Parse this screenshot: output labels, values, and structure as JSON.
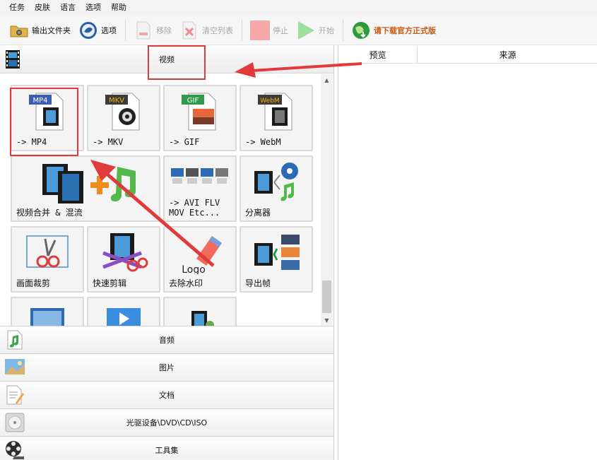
{
  "menu": [
    "任务",
    "皮肤",
    "语言",
    "选项",
    "帮助"
  ],
  "toolbar": {
    "output_folder": "输出文件夹",
    "options": "选项",
    "remove": "移除",
    "clear_list": "清空列表",
    "stop": "停止",
    "start": "开始",
    "download_official": "请下载官方正式版"
  },
  "category": {
    "current": "视频"
  },
  "tiles": [
    {
      "label": "-> MP4",
      "badge": "MP4",
      "badge_color": "#3a5fae"
    },
    {
      "label": "-> MKV",
      "badge": "MKV",
      "badge_color": "#3c3c3c"
    },
    {
      "label": "-> GIF",
      "badge": "GIF",
      "badge_color": "#2e9a4a"
    },
    {
      "label": "-> WebM",
      "badge": "WebM",
      "badge_color": "#3c3c3c"
    },
    {
      "label": "视频合并 & 混流"
    },
    {
      "label": "-> AVI FLV\nMOV Etc..."
    },
    {
      "label": "分离器"
    },
    {
      "label": "画面裁剪"
    },
    {
      "label": "快速剪辑"
    },
    {
      "label": "去除水印",
      "logo_text": "Logo"
    },
    {
      "label": "导出帧"
    }
  ],
  "categories": [
    "音频",
    "图片",
    "文档",
    "光驱设备\\DVD\\CD\\ISO",
    "工具集"
  ],
  "list_columns": [
    "预览",
    "来源"
  ],
  "colors": {
    "annotation": "#e03a3a",
    "promo": "#c85a10"
  }
}
